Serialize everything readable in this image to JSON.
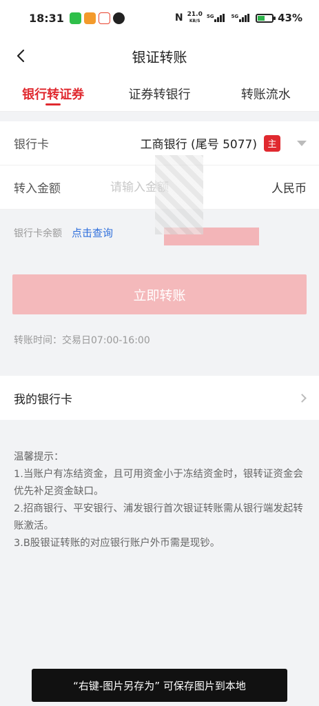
{
  "status_bar": {
    "time": "18:31",
    "app_icons": [
      {
        "name": "wechat-icon",
        "color": "#2fbf4a"
      },
      {
        "name": "app-orange-icon",
        "color": "#f39a2b"
      },
      {
        "name": "weibo-icon",
        "color": "#e8412c"
      },
      {
        "name": "penguin-icon",
        "color": "#222222"
      }
    ],
    "nfc_label": "N",
    "net_speed": "21.0",
    "net_speed_unit": "KB/S",
    "signal_labels": [
      "5G",
      "5G"
    ],
    "battery_percent": "43%",
    "battery_level": 0.43
  },
  "nav": {
    "title": "银证转账",
    "back_icon": "chevron-left-icon"
  },
  "tabs": [
    {
      "label": "银行转证券",
      "active": true
    },
    {
      "label": "证券转银行",
      "active": false
    },
    {
      "label": "转账流水",
      "active": false
    }
  ],
  "form": {
    "bank_card_label": "银行卡",
    "bank_card_value": "工商银行 (尾号 5077)",
    "main_badge": "主",
    "amount_label": "转入金额",
    "amount_placeholder": "请输入金额",
    "amount_value": "",
    "currency": "人民币"
  },
  "balance": {
    "label": "银行卡余额",
    "link": "点击查询"
  },
  "submit_label": "立即转账",
  "time_note": "转账时间：交易日07:00-16:00",
  "my_cards_label": "我的银行卡",
  "tips": {
    "title": "温馨提示：",
    "items": [
      "1.当账户有冻结资金，且可用资金小于冻结资金时，银转证资金会优先补足资金缺口。",
      "2.招商银行、平安银行、浦发银行首次银证转账需从银行端发起转账激活。",
      "3.B股银证转账的对应银行账户外币需是现钞。"
    ]
  },
  "toast": "“右键-图片另存为” 可保存图片到本地",
  "colors": {
    "accent": "#e0292f",
    "button_disabled": "#f4b9bb",
    "link": "#2f6fdc"
  }
}
